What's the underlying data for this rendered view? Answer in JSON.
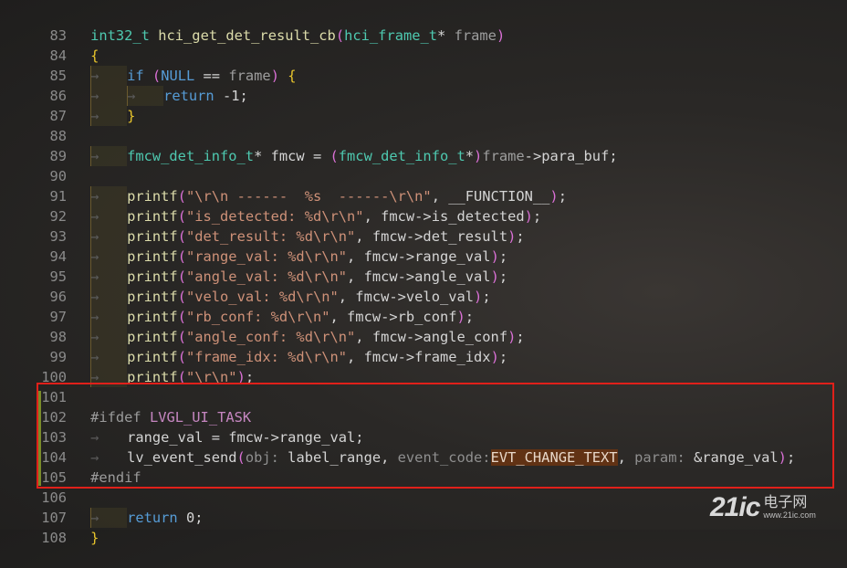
{
  "editor": {
    "lines": [
      {
        "n": "83"
      },
      {
        "n": "84"
      },
      {
        "n": "85"
      },
      {
        "n": "86"
      },
      {
        "n": "87"
      },
      {
        "n": "88"
      },
      {
        "n": "89"
      },
      {
        "n": "90"
      },
      {
        "n": "91"
      },
      {
        "n": "92"
      },
      {
        "n": "93"
      },
      {
        "n": "94"
      },
      {
        "n": "95"
      },
      {
        "n": "96"
      },
      {
        "n": "97"
      },
      {
        "n": "98"
      },
      {
        "n": "99"
      },
      {
        "n": "100"
      },
      {
        "n": "101"
      },
      {
        "n": "102"
      },
      {
        "n": "103"
      },
      {
        "n": "104"
      },
      {
        "n": "105"
      },
      {
        "n": "106"
      },
      {
        "n": "107"
      },
      {
        "n": "108"
      }
    ],
    "code": {
      "l83": {
        "type": "int32_t",
        "fn": "hci_get_det_result_cb",
        "lp": "(",
        "ptype": "hci_frame_t",
        "star": "*",
        "pname": "frame",
        "rp": ")"
      },
      "l84": {
        "brace": "{"
      },
      "l85": {
        "kw": "if",
        "sp": " ",
        "lp": "(",
        "null": "NULL",
        "op": " == ",
        "var": "frame",
        "rp": ")",
        "brace": "{"
      },
      "l86": {
        "kw": "return",
        "val": " -1;"
      },
      "l87": {
        "brace": "}"
      },
      "l89": {
        "type": "fmcw_det_info_t",
        "rest": "* fmcw = ",
        "lp": "(",
        "cast": "fmcw_det_info_t",
        "star": "*",
        "rp": ")",
        "var": "frame",
        "tail": "->para_buf;"
      },
      "l91": {
        "fn": "printf",
        "lp": "(",
        "str": "\"\\r\\n ------  %s  ------\\r\\n\"",
        "mid": ", __FUNCTION__",
        "rp": ")",
        "end": ";"
      },
      "l92": {
        "fn": "printf",
        "lp": "(",
        "str": "\"is_detected: %d\\r\\n\"",
        "mid": ", fmcw->is_detected",
        "rp": ")",
        "end": ";"
      },
      "l93": {
        "fn": "printf",
        "lp": "(",
        "str": "\"det_result: %d\\r\\n\"",
        "mid": ", fmcw->det_result",
        "rp": ")",
        "end": ";"
      },
      "l94": {
        "fn": "printf",
        "lp": "(",
        "str": "\"range_val: %d\\r\\n\"",
        "mid": ", fmcw->range_val",
        "rp": ")",
        "end": ";"
      },
      "l95": {
        "fn": "printf",
        "lp": "(",
        "str": "\"angle_val: %d\\r\\n\"",
        "mid": ", fmcw->angle_val",
        "rp": ")",
        "end": ";"
      },
      "l96": {
        "fn": "printf",
        "lp": "(",
        "str": "\"velo_val: %d\\r\\n\"",
        "mid": ", fmcw->velo_val",
        "rp": ")",
        "end": ";"
      },
      "l97": {
        "fn": "printf",
        "lp": "(",
        "str": "\"rb_conf: %d\\r\\n\"",
        "mid": ", fmcw->rb_conf",
        "rp": ")",
        "end": ";"
      },
      "l98": {
        "fn": "printf",
        "lp": "(",
        "str": "\"angle_conf: %d\\r\\n\"",
        "mid": ", fmcw->angle_conf",
        "rp": ")",
        "end": ";"
      },
      "l99": {
        "fn": "printf",
        "lp": "(",
        "str": "\"frame_idx: %d\\r\\n\"",
        "mid": ", fmcw->frame_idx",
        "rp": ")",
        "end": ";"
      },
      "l100": {
        "fn": "printf",
        "lp": "(",
        "str": "\"\\r\\n\"",
        "mid": "",
        "rp": ")",
        "end": ";"
      },
      "l102": {
        "pp": "#ifdef ",
        "macro": "LVGL_UI_TASK"
      },
      "l103": {
        "code": "range_val = fmcw->range_val;"
      },
      "l104": {
        "fn": "lv_event_send",
        "lp": "(",
        "h1": "obj:",
        "a1": " label_range, ",
        "h2": "event_code:",
        "a2": "EVT_CHANGE_TEXT",
        "sep": ", ",
        "h3": "param:",
        "a3": " &range_val",
        "rp": ")",
        "end": ";"
      },
      "l105": {
        "pp": "#endif"
      },
      "l107": {
        "kw": "return",
        "val": " 0;"
      },
      "l108": {
        "brace": "}"
      }
    },
    "tab_glyph": "→"
  },
  "watermark": {
    "logo": "21ic",
    "cn": "电子网",
    "url": "www.21ic.com"
  },
  "colors": {
    "highlight_box": "#e0201a",
    "background": "#2a2826"
  }
}
